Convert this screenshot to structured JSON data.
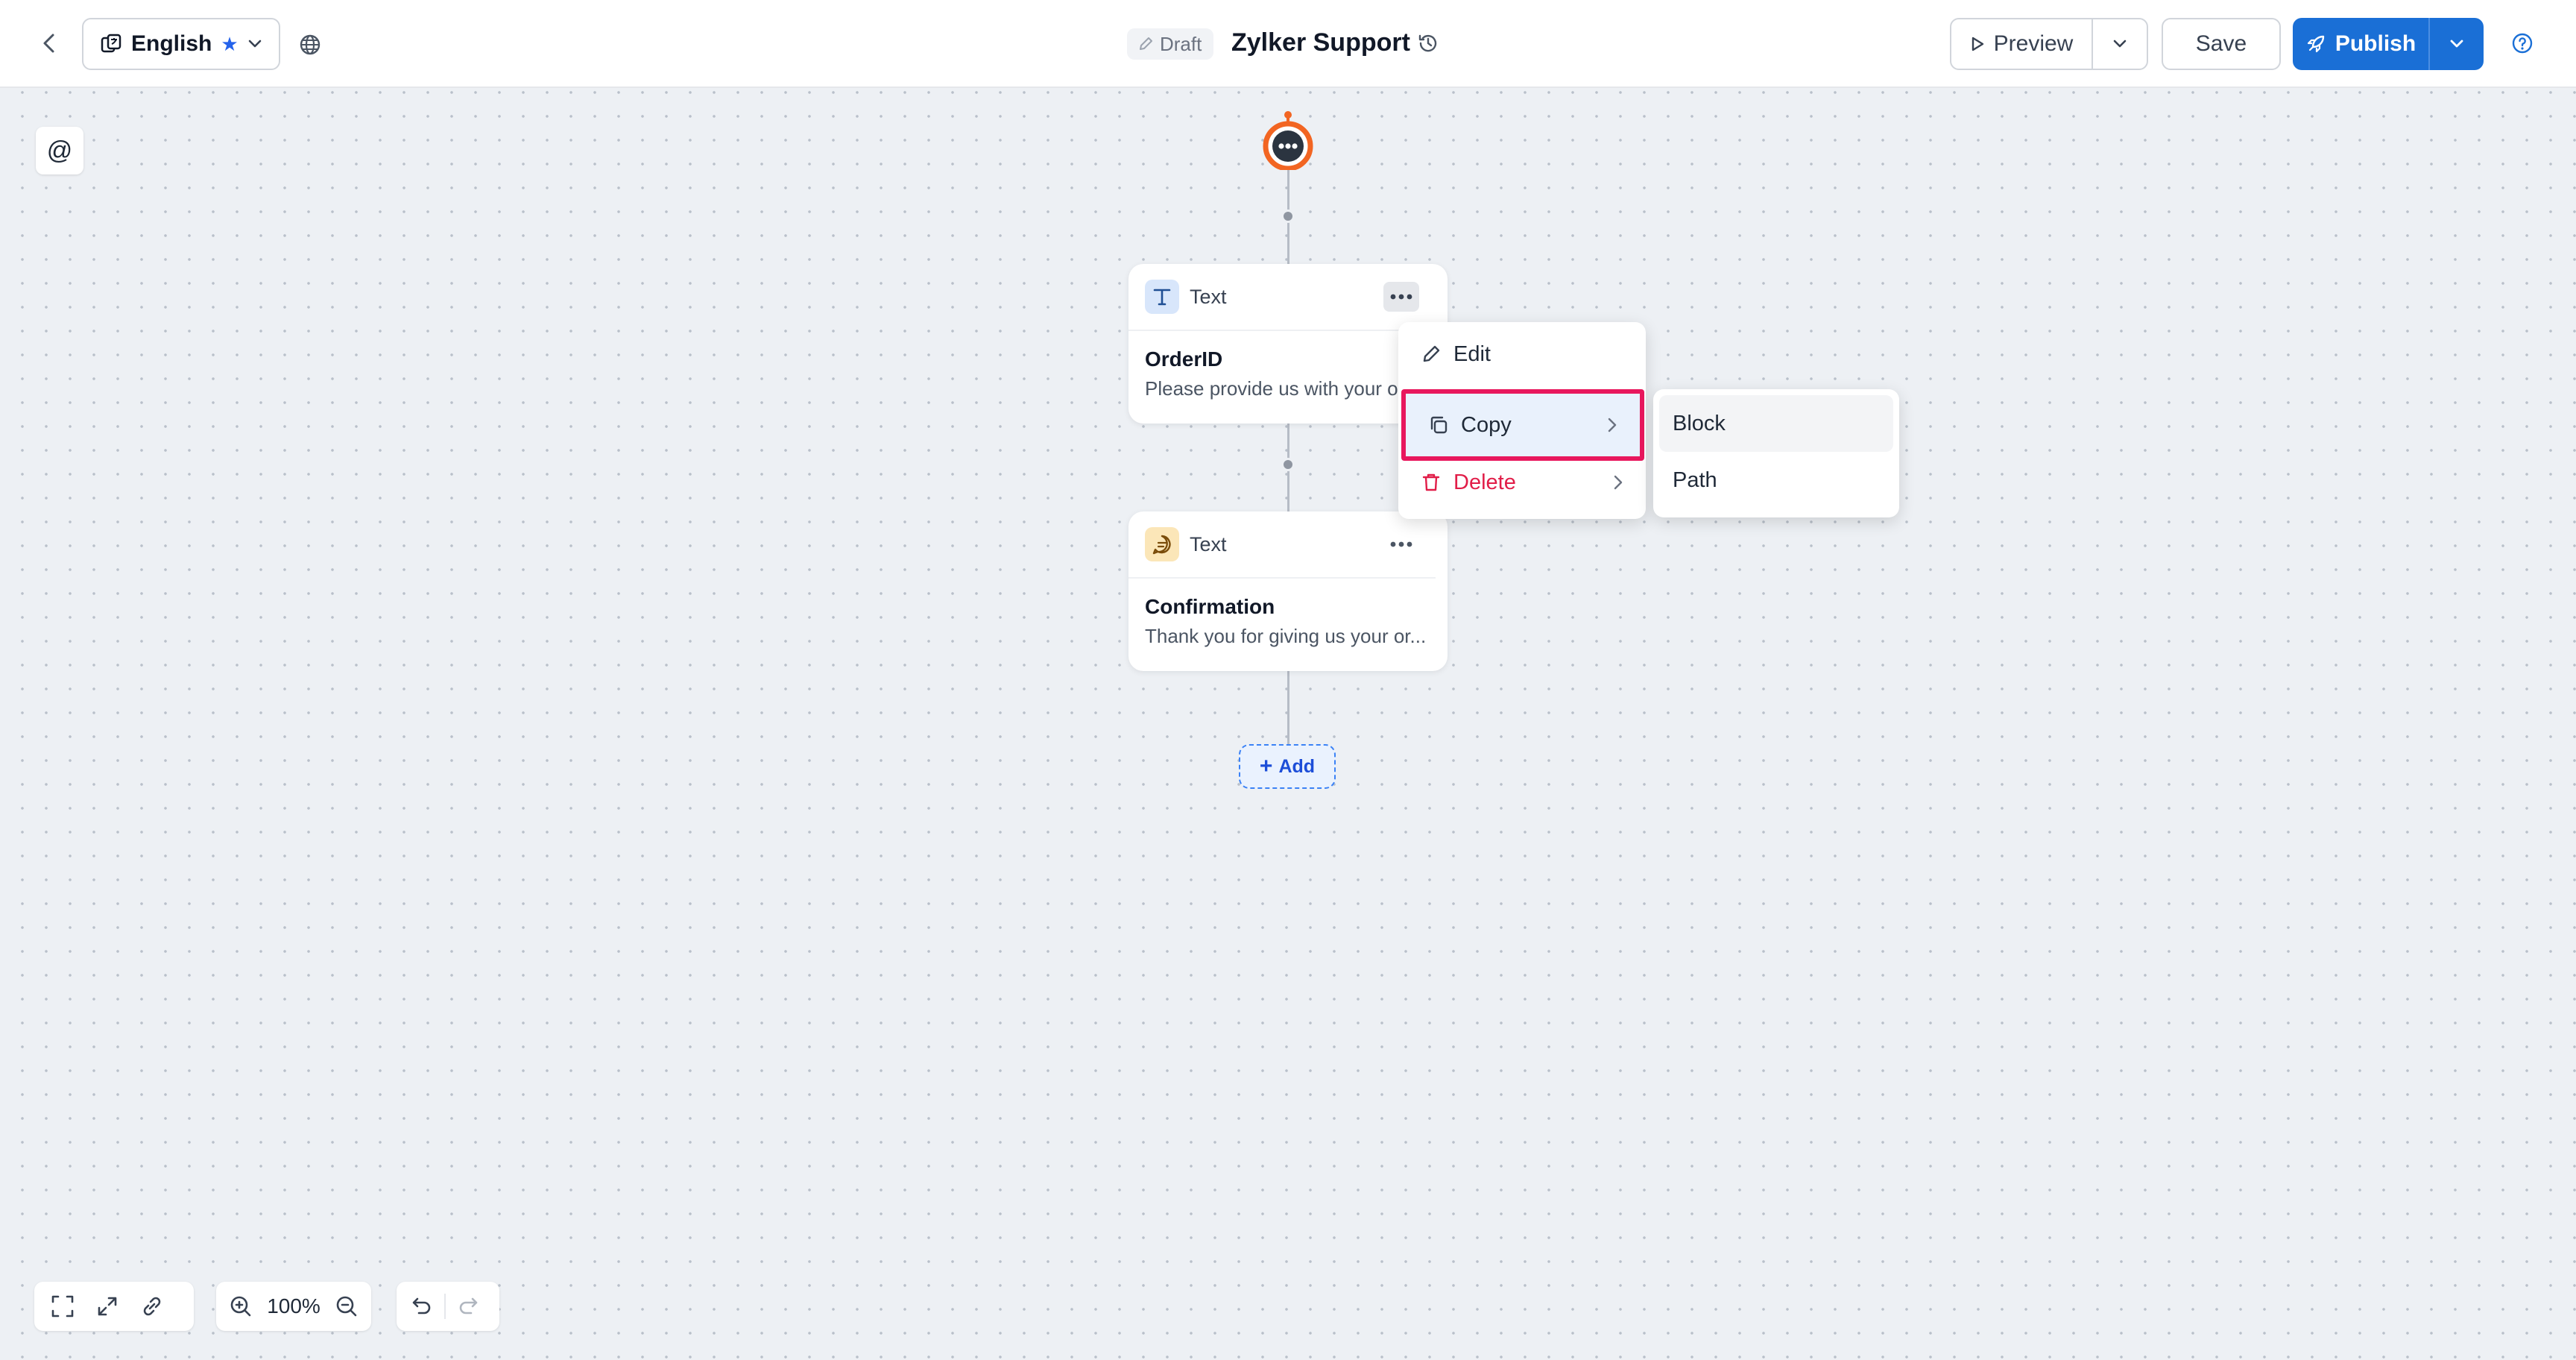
{
  "header": {
    "back_label": "",
    "language": "English",
    "status_badge": "Draft",
    "title": "Zylker Support",
    "preview_label": "Preview",
    "save_label": "Save",
    "publish_label": "Publish"
  },
  "canvas": {
    "mention_symbol": "@",
    "nodes": [
      {
        "type_label": "Text",
        "title": "OrderID",
        "description": "Please provide us with your order ID"
      },
      {
        "type_label": "Text",
        "title": "Confirmation",
        "description": "Thank you for giving us your or..."
      }
    ],
    "add_label": "Add"
  },
  "context_menu": {
    "items": [
      {
        "label": "Edit"
      },
      {
        "label": "Copy"
      },
      {
        "label": "Delete"
      }
    ],
    "submenu": [
      {
        "label": "Block"
      },
      {
        "label": "Path"
      }
    ]
  },
  "toolbar": {
    "zoom": "100%"
  },
  "colors": {
    "accent": "#1a6fd6",
    "danger": "#e11d48",
    "highlight_border": "#e8175d",
    "bot_orange": "#f26522"
  }
}
